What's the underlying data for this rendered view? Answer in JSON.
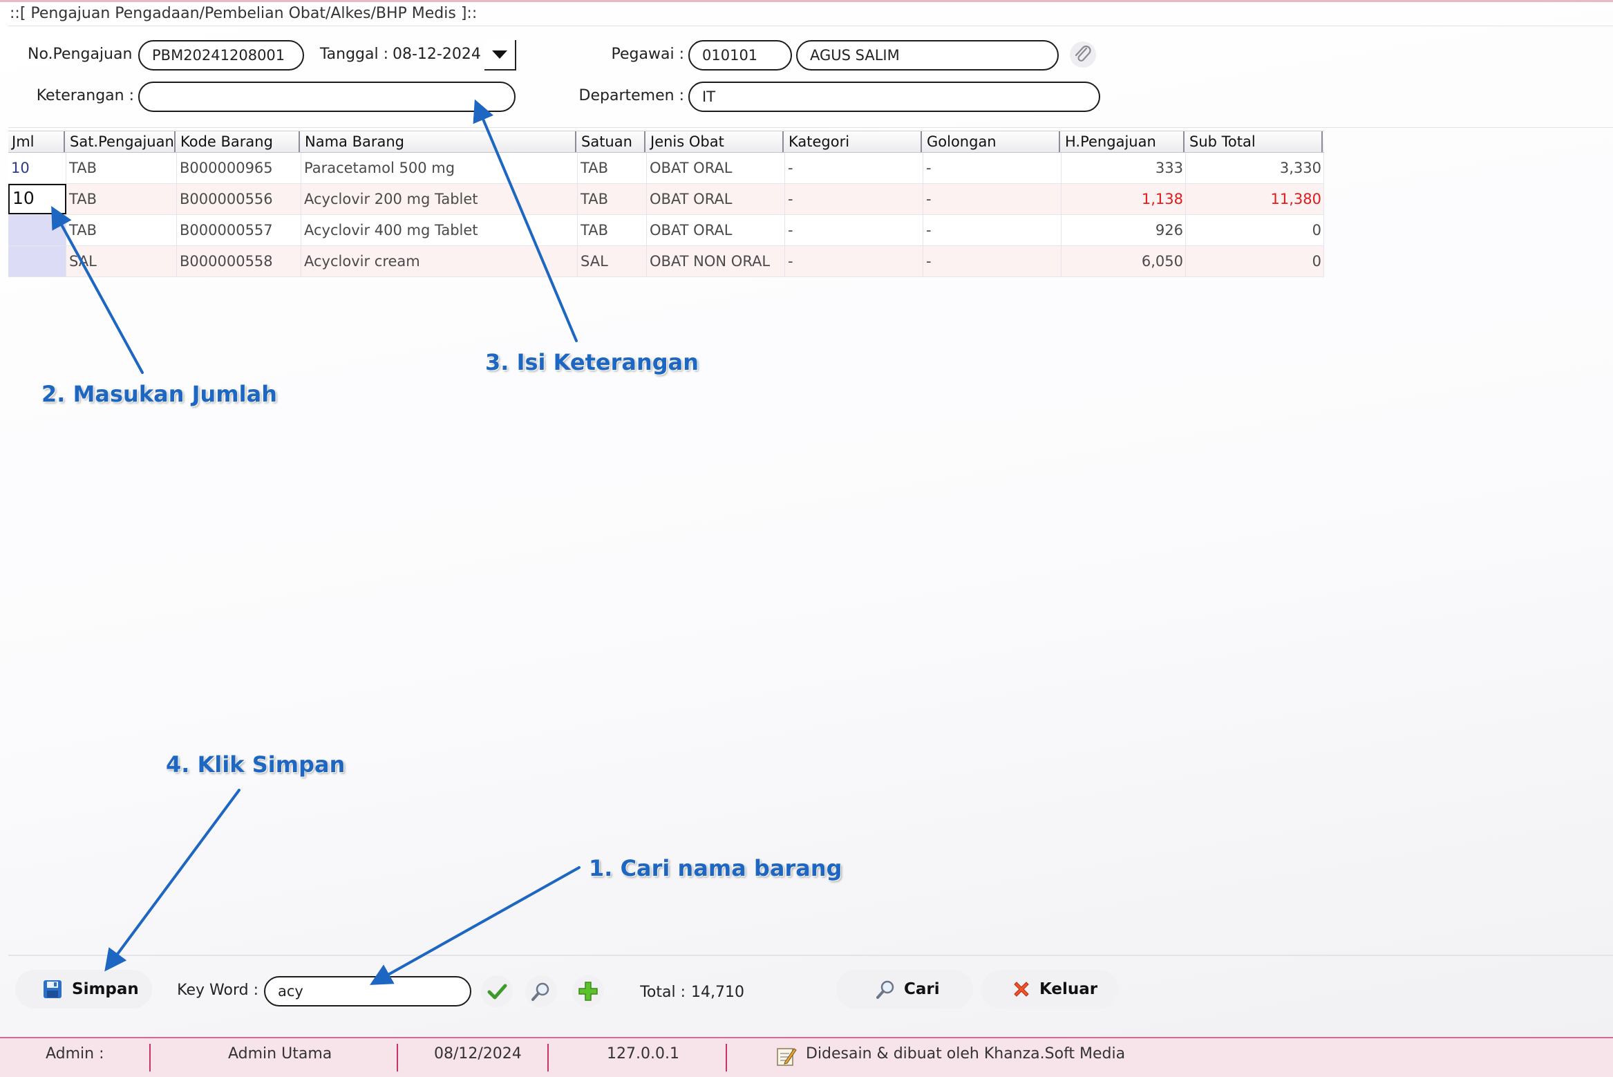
{
  "window": {
    "title": "::[ Pengajuan Pengadaan/Pembelian Obat/Alkes/BHP Medis ]::"
  },
  "form": {
    "no_pengajuan_label": "No.Pengajuan :",
    "no_pengajuan_value": "PBM20241208001",
    "tanggal_label": "Tanggal :",
    "tanggal_value": "08-12-2024",
    "pegawai_label": "Pegawai :",
    "pegawai_code": "010101",
    "pegawai_name": "AGUS SALIM",
    "keterangan_label": "Keterangan :",
    "keterangan_value": "",
    "departemen_label": "Departemen :",
    "departemen_value": "IT"
  },
  "table": {
    "columns": [
      "Jml",
      "Sat.Pengajuan",
      "Kode Barang",
      "Nama Barang",
      "Satuan",
      "Jenis Obat",
      "Kategori",
      "Golongan",
      "H.Pengajuan",
      "Sub Total"
    ],
    "rows": [
      {
        "jml": "10",
        "sat": "TAB",
        "kode": "B000000965",
        "nama": "Paracetamol 500 mg",
        "satuan": "TAB",
        "jenis": "OBAT ORAL",
        "kategori": "-",
        "golongan": "-",
        "harga": "333",
        "subtotal": "3,330"
      },
      {
        "jml": "10",
        "sat": "TAB",
        "kode": "B000000556",
        "nama": "Acyclovir 200 mg Tablet",
        "satuan": "TAB",
        "jenis": "OBAT ORAL",
        "kategori": "-",
        "golongan": "-",
        "harga": "1,138",
        "subtotal": "11,380"
      },
      {
        "jml": "",
        "sat": "TAB",
        "kode": "B000000557",
        "nama": "Acyclovir 400 mg Tablet",
        "satuan": "TAB",
        "jenis": "OBAT ORAL",
        "kategori": "-",
        "golongan": "-",
        "harga": "926",
        "subtotal": "0"
      },
      {
        "jml": "",
        "sat": "SAL",
        "kode": "B000000558",
        "nama": "Acyclovir cream",
        "satuan": "SAL",
        "jenis": "OBAT NON ORAL",
        "kategori": "-",
        "golongan": "-",
        "harga": "6,050",
        "subtotal": "0"
      }
    ]
  },
  "toolbar": {
    "simpan_label": "Simpan",
    "keyword_label": "Key Word :",
    "keyword_value": "acy",
    "total_label": "Total :",
    "total_value": "14,710",
    "cari_label": "Cari",
    "keluar_label": "Keluar"
  },
  "statusbar": {
    "admin_label": "Admin :",
    "admin_name": "Admin Utama",
    "date": "08/12/2024",
    "ip": "127.0.0.1",
    "credit": "Didesain & dibuat oleh Khanza.Soft Media"
  },
  "annotations": {
    "step1": "1. Cari nama barang",
    "step2": "2. Masukan Jumlah",
    "step3": "3. Isi Keterangan",
    "step4": "4. Klik Simpan"
  },
  "colors": {
    "accent": "#1d66c2",
    "highlight_red": "#e01b1b",
    "statusbar": "#f7e3ea"
  }
}
